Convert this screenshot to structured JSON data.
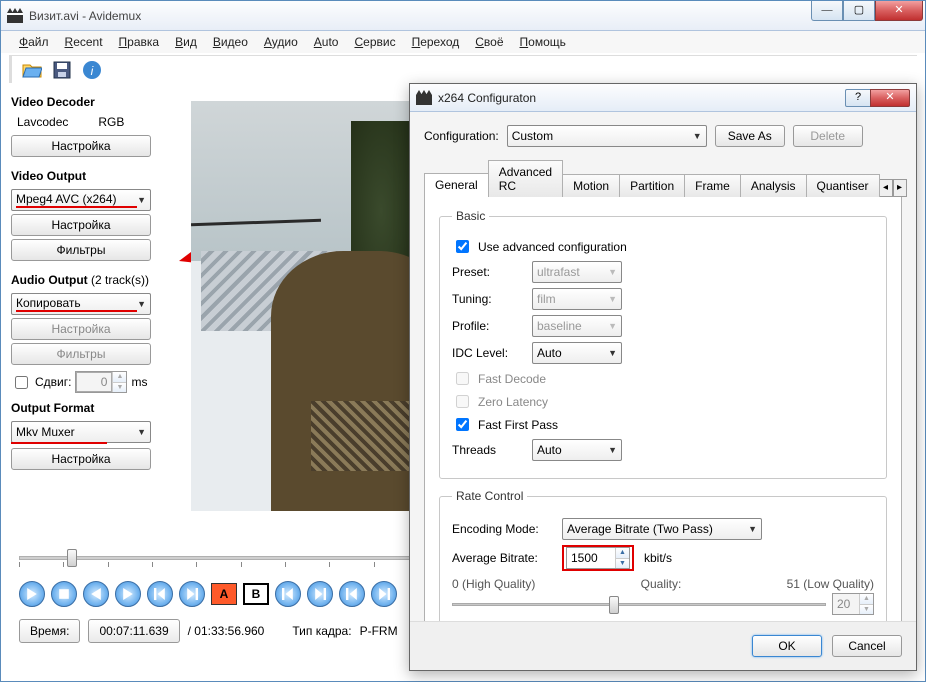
{
  "window": {
    "title": "Визит.avi - Avidemux",
    "menu": [
      "Файл",
      "Recent",
      "Правка",
      "Вид",
      "Видео",
      "Аудио",
      "Auto",
      "Сервис",
      "Переход",
      "Своё",
      "Помощь"
    ]
  },
  "decoder": {
    "heading": "Video Decoder",
    "codec": "Lavcodec",
    "colorspace": "RGB",
    "configure": "Настройка"
  },
  "video_output": {
    "heading": "Video Output",
    "codec": "Mpeg4 AVC (x264)",
    "configure": "Настройка",
    "filters": "Фильтры"
  },
  "audio_output": {
    "heading": "Audio Output",
    "tracks": "(2 track(s))",
    "mode": "Копировать",
    "configure": "Настройка",
    "filters": "Фильтры",
    "shift_label": "Сдвиг:",
    "shift_value": "0",
    "shift_unit": "ms"
  },
  "output_format": {
    "heading": "Output Format",
    "muxer": "Mkv Muxer",
    "configure": "Настройка"
  },
  "status": {
    "time_label": "Время:",
    "time_value": "00:07:11.639",
    "duration": "/ 01:33:56.960",
    "frame_type_label": "Тип кадра:",
    "frame_type_value": "P-FRM"
  },
  "dialog": {
    "title": "x264 Configuraton",
    "config_label": "Configuration:",
    "config_value": "Custom",
    "save_as": "Save As",
    "delete": "Delete",
    "tabs": [
      "General",
      "Advanced RC",
      "Motion",
      "Partition",
      "Frame",
      "Analysis",
      "Quantiser"
    ],
    "basic": {
      "legend": "Basic",
      "use_advanced": "Use advanced configuration",
      "preset_label": "Preset:",
      "preset_value": "ultrafast",
      "tuning_label": "Tuning:",
      "tuning_value": "film",
      "profile_label": "Profile:",
      "profile_value": "baseline",
      "idc_label": "IDC Level:",
      "idc_value": "Auto",
      "fast_decode": "Fast Decode",
      "zero_latency": "Zero Latency",
      "fast_first_pass": "Fast First Pass",
      "threads_label": "Threads",
      "threads_value": "Auto"
    },
    "rate": {
      "legend": "Rate Control",
      "mode_label": "Encoding Mode:",
      "mode_value": "Average Bitrate (Two Pass)",
      "bitrate_label": "Average Bitrate:",
      "bitrate_value": "1500",
      "bitrate_unit": "kbit/s",
      "q_left": "0 (High Quality)",
      "q_mid": "Quality:",
      "q_right": "51 (Low Quality)",
      "q_value": "20"
    },
    "ok": "OK",
    "cancel": "Cancel"
  }
}
